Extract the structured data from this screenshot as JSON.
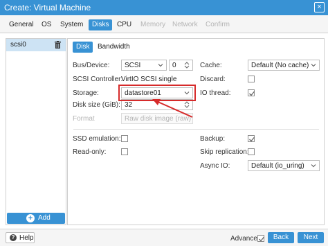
{
  "window": {
    "title": "Create: Virtual Machine",
    "close_glyph": "×"
  },
  "tabs": [
    {
      "label": "General",
      "state": "enabled"
    },
    {
      "label": "OS",
      "state": "enabled"
    },
    {
      "label": "System",
      "state": "enabled"
    },
    {
      "label": "Disks",
      "state": "active"
    },
    {
      "label": "CPU",
      "state": "enabled"
    },
    {
      "label": "Memory",
      "state": "disabled"
    },
    {
      "label": "Network",
      "state": "disabled"
    },
    {
      "label": "Confirm",
      "state": "disabled"
    }
  ],
  "disk_list": {
    "items": [
      {
        "label": "scsi0",
        "selected": true,
        "icon": "trash-icon"
      }
    ],
    "add_label": "Add",
    "add_icon": "plus-circle-icon"
  },
  "subtabs": [
    {
      "label": "Disk",
      "active": true
    },
    {
      "label": "Bandwidth",
      "active": false
    }
  ],
  "form": {
    "bus_device": {
      "label": "Bus/Device:",
      "bus": "SCSI",
      "device": "0"
    },
    "scsi_controller": {
      "label": "SCSI Controller:",
      "value": "VirtIO SCSI single"
    },
    "storage": {
      "label": "Storage:",
      "value": "datastore01"
    },
    "disk_size": {
      "label": "Disk size (GiB):",
      "value": "32"
    },
    "format": {
      "label": "Format",
      "value": "Raw disk image (raw)",
      "disabled": true
    },
    "cache": {
      "label": "Cache:",
      "value": "Default (No cache)"
    },
    "discard": {
      "label": "Discard:",
      "checked": false
    },
    "io_thread": {
      "label": "IO thread:",
      "checked": true
    },
    "ssd_emulation": {
      "label": "SSD emulation:",
      "checked": false
    },
    "read_only": {
      "label": "Read-only:",
      "checked": false
    },
    "backup": {
      "label": "Backup:",
      "checked": true
    },
    "skip_replication": {
      "label": "Skip replication:",
      "checked": false
    },
    "async_io": {
      "label": "Async IO:",
      "value": "Default (io_uring)"
    }
  },
  "annotation": {
    "color": "#d62a2a",
    "highlighted_field": "storage"
  },
  "footer": {
    "help_label": "Help",
    "advanced_label": "Advanced",
    "advanced_checked": true,
    "back_label": "Back",
    "next_label": "Next"
  },
  "colors": {
    "accent": "#3892d4",
    "selected_row": "#cde3f4",
    "annotation": "#d62a2a"
  }
}
